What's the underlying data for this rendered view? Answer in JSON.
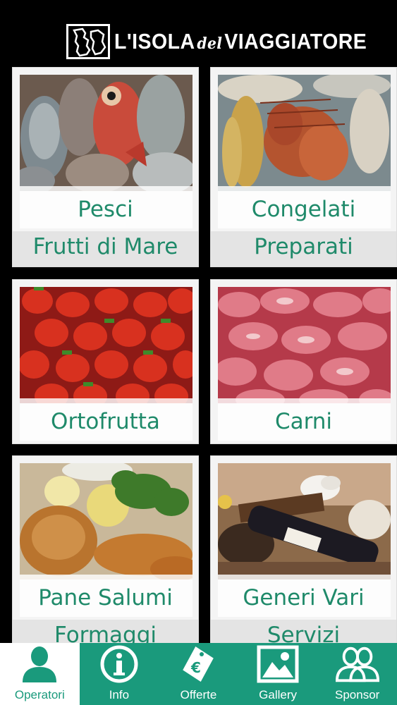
{
  "header": {
    "brand_part1": "L'ISOLA",
    "brand_part2": "del",
    "brand_part3": "VIAGGIATORE"
  },
  "categories": [
    {
      "label1": "Pesci",
      "label2": "Frutti di Mare",
      "image": "fish-photo"
    },
    {
      "label1": "Congelati",
      "label2": "Preparati",
      "image": "frozen-shrimp-photo"
    },
    {
      "label1": "Ortofrutta",
      "label2": "",
      "image": "strawberries-photo"
    },
    {
      "label1": "Carni",
      "label2": "",
      "image": "meat-photo"
    },
    {
      "label1": "Pane Salumi",
      "label2": "Formaggi",
      "image": "bread-cheese-photo"
    },
    {
      "label1": "Generi Vari",
      "label2": "Servizi",
      "image": "wine-misc-photo"
    }
  ],
  "tabs": [
    {
      "label": "Operatori",
      "icon": "person-icon",
      "active": true
    },
    {
      "label": "Info",
      "icon": "info-icon",
      "active": false
    },
    {
      "label": "Offerte",
      "icon": "euro-tag-icon",
      "active": false
    },
    {
      "label": "Gallery",
      "icon": "picture-icon",
      "active": false
    },
    {
      "label": "Sponsor",
      "icon": "group-icon",
      "active": false
    }
  ],
  "colors": {
    "accent": "#1a9a7c",
    "label_text": "#1f8a6a",
    "background": "#000000"
  }
}
